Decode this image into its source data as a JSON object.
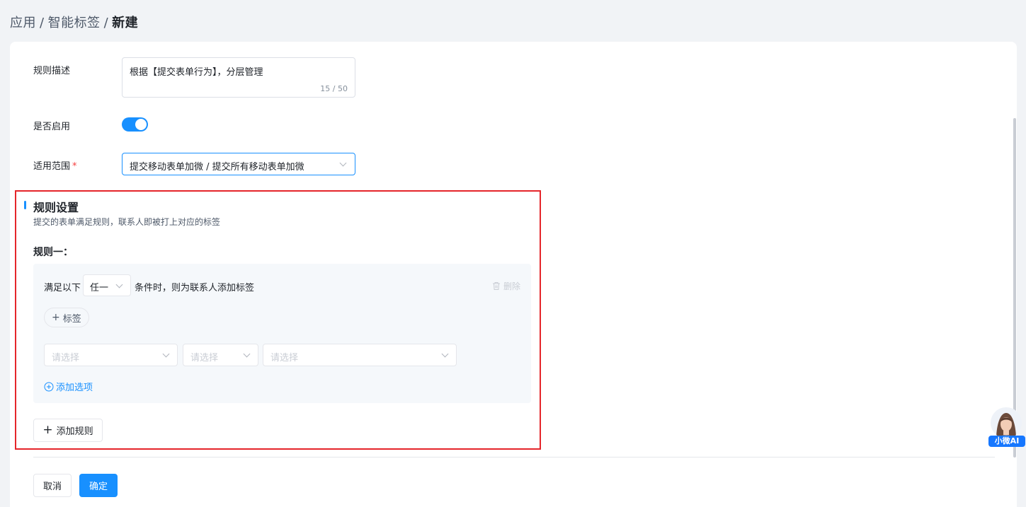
{
  "breadcrumb": {
    "part1": "应用",
    "part2": "智能标签",
    "part3": "新建",
    "separator": "/"
  },
  "form": {
    "desc_label": "规则描述",
    "desc_value": "根据【提交表单行为】，分层管理",
    "desc_count": "15 / 50",
    "enable_label": "是否启用",
    "enable_on": true,
    "scope_label": "适用范围",
    "required_mark": "*",
    "scope_value": "提交移动表单加微 / 提交所有移动表单加微"
  },
  "rules_section": {
    "title": "规则设置",
    "subtitle": "提交的表单满足规则，联系人即被打上对应的标签",
    "rule1": {
      "title": "规则一：",
      "cond_prefix": "满足以下",
      "match_value": "任一",
      "cond_suffix": "条件时，则为联系人添加标签",
      "delete_label": "删除",
      "tag_button": "标签",
      "tag_plus": "+",
      "selects": [
        "请选择",
        "请选择",
        "请选择"
      ],
      "add_option": "添加选项"
    },
    "add_rule_plus": "+",
    "add_rule": "添加规则"
  },
  "footer": {
    "cancel": "取消",
    "confirm": "确定"
  },
  "assistant": {
    "label": "小微AI"
  },
  "colors": {
    "primary": "#1890ff",
    "highlight": "#e5252a",
    "required": "#f53f3f"
  }
}
